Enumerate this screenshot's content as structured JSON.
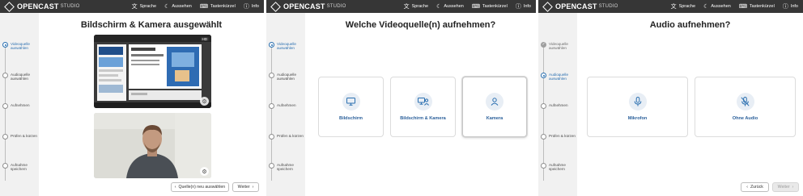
{
  "app": {
    "brand": "OPENCAST",
    "brand_sub": "STUDIO"
  },
  "nav": {
    "language": "Sprache",
    "appearance": "Aussehen",
    "shortcuts": "Tastenkürzel",
    "info": "Info"
  },
  "steps": {
    "source": "Videoquelle auswählen",
    "audio": "Audioquelle auswählen",
    "record": "Aufnehmen",
    "review": "Prüfen & kürzen",
    "save": "Aufnahme speichern"
  },
  "panel1": {
    "title": "Bildschirm & Kamera ausgewählt",
    "reselect": "Quelle(n) neu auswählen",
    "next": "Weiter",
    "screen_badge": "HD"
  },
  "panel2": {
    "title": "Welche Videoquelle(n) aufnehmen?",
    "options": [
      "Bildschirm",
      "Bildschirm & Kamera",
      "Kamera"
    ]
  },
  "panel3": {
    "title": "Audio aufnehmen?",
    "options": [
      "Mikrofon",
      "Ohne Audio"
    ],
    "back": "Zurück",
    "next": "Weiter"
  },
  "colors": {
    "header": "#363636",
    "accent": "#2a6fb0",
    "sidebar": "#f1f1f1"
  },
  "icons": {
    "language": "translate-icon",
    "appearance": "moon-icon",
    "shortcuts": "keyboard-icon",
    "info": "info-icon",
    "screen": "monitor-icon",
    "screen_camera": "monitor-user-icon",
    "camera": "user-icon",
    "microphone": "microphone-icon",
    "no_audio": "microphone-off-icon"
  }
}
